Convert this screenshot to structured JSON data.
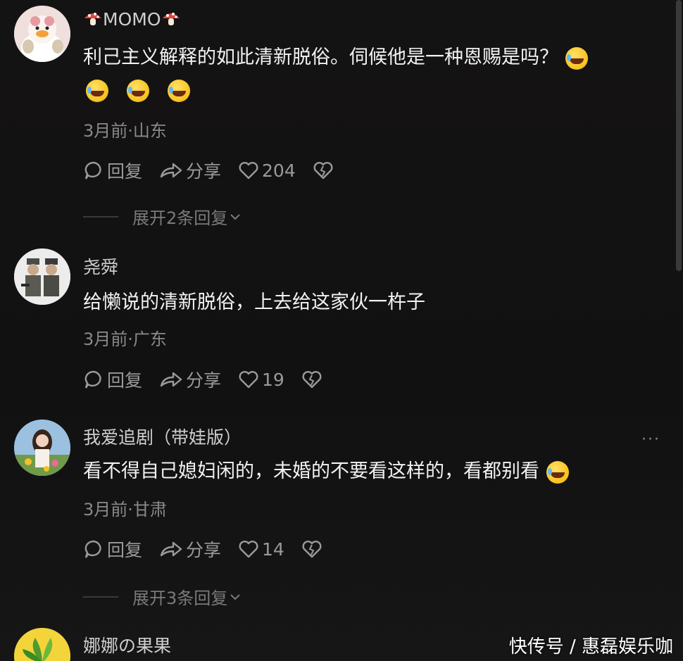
{
  "comments": [
    {
      "username": "MOMO",
      "text": "利己主义解释的如此清新脱俗。伺候他是一种恩赐是吗？",
      "meta": "3月前·山东",
      "reply_label": "回复",
      "share_label": "分享",
      "likes": "204",
      "expand_label": "展开2条回复"
    },
    {
      "username": "尧舜",
      "text": "给懒说的清新脱俗，上去给这家伙一杵子",
      "meta": "3月前·广东",
      "reply_label": "回复",
      "share_label": "分享",
      "likes": "19"
    },
    {
      "username": "我爱追剧（带娃版）",
      "text": "看不得自己媳妇闲的，未婚的不要看这样的，看都别看",
      "meta": "3月前·甘肃",
      "reply_label": "回复",
      "share_label": "分享",
      "likes": "14",
      "expand_label": "展开3条回复",
      "more": "···"
    },
    {
      "username": "娜娜の果果"
    }
  ],
  "watermark": "快传号 / 惠磊娱乐咖",
  "colors": {
    "background": "#121111",
    "text_primary": "#f2f2f2",
    "text_secondary": "#8a8a8a"
  }
}
